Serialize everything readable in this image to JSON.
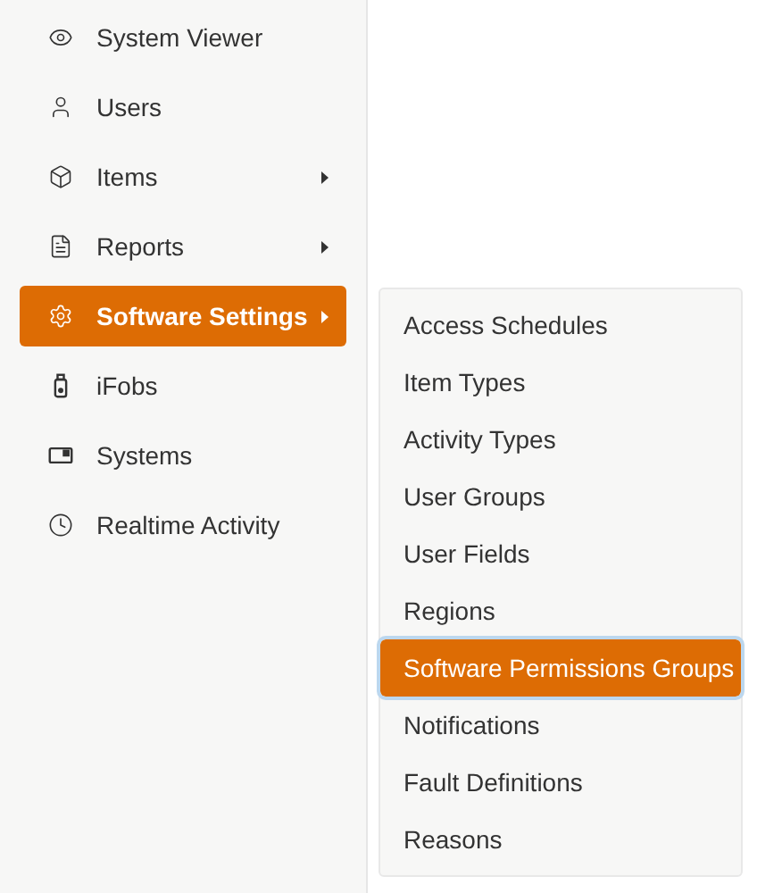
{
  "sidebar": {
    "items": [
      {
        "label": "System Viewer",
        "selected": false,
        "has_submenu": false
      },
      {
        "label": "Users",
        "selected": false,
        "has_submenu": false
      },
      {
        "label": "Items",
        "selected": false,
        "has_submenu": true
      },
      {
        "label": "Reports",
        "selected": false,
        "has_submenu": true
      },
      {
        "label": "Software Settings",
        "selected": true,
        "has_submenu": true
      },
      {
        "label": "iFobs",
        "selected": false,
        "has_submenu": false
      },
      {
        "label": "Systems",
        "selected": false,
        "has_submenu": false
      },
      {
        "label": "Realtime Activity",
        "selected": false,
        "has_submenu": false
      }
    ]
  },
  "submenu": {
    "items": [
      {
        "label": "Access Schedules",
        "selected": false
      },
      {
        "label": "Item Types",
        "selected": false
      },
      {
        "label": "Activity Types",
        "selected": false
      },
      {
        "label": "User Groups",
        "selected": false
      },
      {
        "label": "User Fields",
        "selected": false
      },
      {
        "label": "Regions",
        "selected": false
      },
      {
        "label": "Software Permissions Groups",
        "selected": true
      },
      {
        "label": "Notifications",
        "selected": false
      },
      {
        "label": "Fault Definitions",
        "selected": false
      },
      {
        "label": "Reasons",
        "selected": false
      }
    ]
  }
}
